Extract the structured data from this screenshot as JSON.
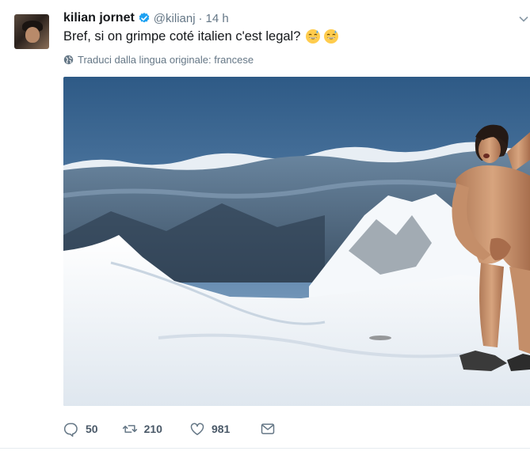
{
  "tweet": {
    "author_name": "kilian jornet",
    "handle": "@kilianj",
    "separator": "·",
    "time": "14 h",
    "text": "Bref, si on grimpe coté italien c'est legal?",
    "translate_label": "Traduci dalla lingua originale: francese",
    "actions": {
      "replies": "50",
      "retweets": "210",
      "likes": "981"
    }
  },
  "colors": {
    "verified": "#1da1f2",
    "muted": "#657786",
    "text": "#14171a"
  },
  "icons": [
    "verified-badge-icon",
    "globe-icon",
    "reply-icon",
    "retweet-icon",
    "like-icon",
    "direct-message-icon",
    "caret-down-icon",
    "grinning-sweat-emoji"
  ]
}
